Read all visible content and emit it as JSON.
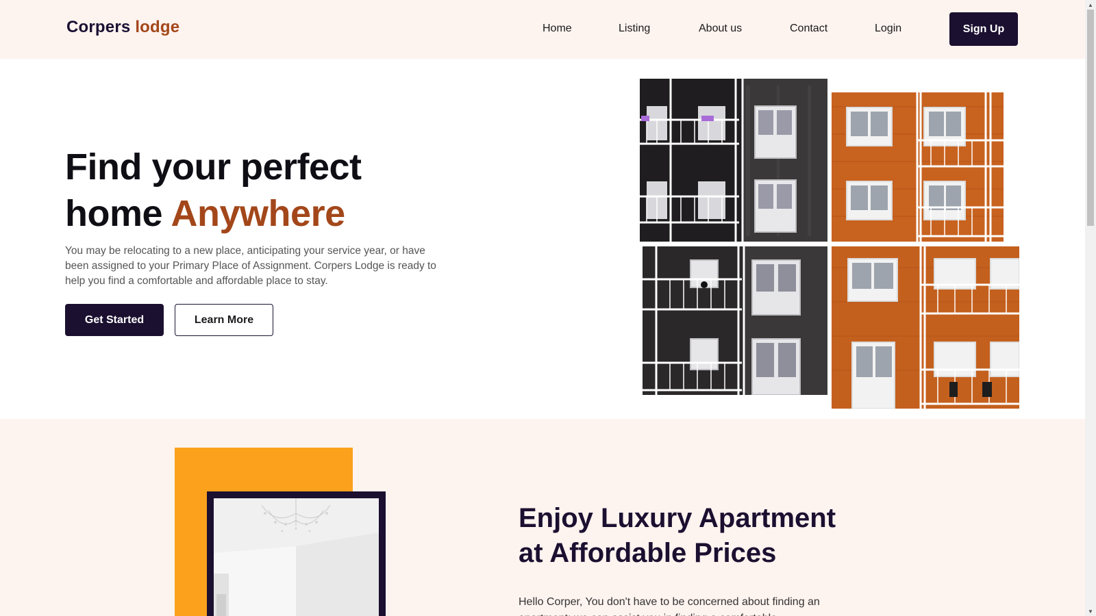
{
  "brand": {
    "name_part1": "Corpers",
    "name_part2": "lodge"
  },
  "nav": {
    "items": [
      "Home",
      "Listing",
      "About us",
      "Contact",
      "Login"
    ],
    "signup_label": "Sign Up"
  },
  "hero": {
    "title_line1": "Find your perfect",
    "title_line2_part1": "home",
    "title_line2_accent": "Anywhere",
    "description": "You may be relocating to a new place, anticipating your service year, or have been assigned to your Primary Place of Assignment. Corpers Lodge is ready to help you find a comfortable and affordable place to stay.",
    "get_started_label": "Get Started",
    "learn_more_label": "Learn More"
  },
  "section2": {
    "title_line1": "Enjoy Luxury Apartment",
    "title_line2": "at Affordable Prices",
    "text": "Hello Corper, You don't have to be concerned about finding an apartment; we can assist you in finding a comfortable"
  },
  "colors": {
    "accent": "#a3471a",
    "dark": "#1b1030",
    "header_bg": "#fdf3ef",
    "orange": "#fba11c"
  },
  "icons": [
    "scroll-up-arrow-icon",
    "scroll-down-arrow-icon"
  ]
}
